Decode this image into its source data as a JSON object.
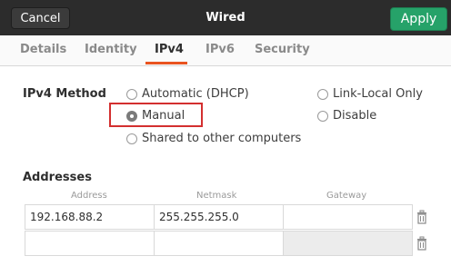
{
  "header": {
    "cancel_label": "Cancel",
    "title": "Wired",
    "apply_label": "Apply"
  },
  "tabs": [
    {
      "label": "Details",
      "active": false
    },
    {
      "label": "Identity",
      "active": false
    },
    {
      "label": "IPv4",
      "active": true
    },
    {
      "label": "IPv6",
      "active": false
    },
    {
      "label": "Security",
      "active": false
    }
  ],
  "ipv4": {
    "method_label": "IPv4 Method",
    "options": [
      {
        "label": "Automatic (DHCP)",
        "checked": false
      },
      {
        "label": "Link-Local Only",
        "checked": false
      },
      {
        "label": "Manual",
        "checked": true
      },
      {
        "label": "Disable",
        "checked": false
      },
      {
        "label": "Shared to other computers",
        "checked": false
      }
    ]
  },
  "addresses": {
    "section_label": "Addresses",
    "columns": [
      "Address",
      "Netmask",
      "Gateway"
    ],
    "rows": [
      {
        "address": "192.168.88.2",
        "netmask": "255.255.255.0",
        "gateway": ""
      },
      {
        "address": "",
        "netmask": "",
        "gateway": ""
      }
    ]
  },
  "colors": {
    "titlebar": "#2c2c2c",
    "apply": "#26a269",
    "accent": "#e95420",
    "highlight": "#d32f2f"
  }
}
